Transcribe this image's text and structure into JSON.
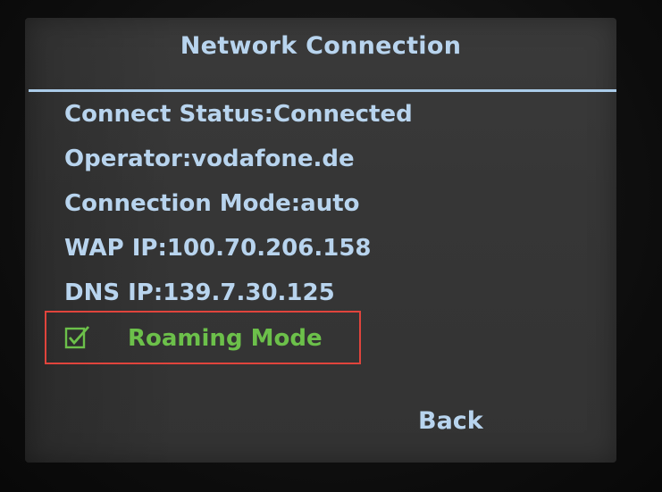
{
  "window": {
    "title": "Network Connection"
  },
  "info": {
    "connect_status": "Connect Status:Connected",
    "operator": "Operator:vodafone.de",
    "connection_mode": "Connection Mode:auto",
    "wap_ip": "WAP IP:100.70.206.158",
    "dns_ip": "DNS IP:139.7.30.125"
  },
  "roaming": {
    "label": "Roaming Mode",
    "checked": true,
    "icon": "checkbox-checked-icon"
  },
  "actions": {
    "back_label": "Back"
  },
  "colors": {
    "screen_bg": "#363636",
    "text": "#b8d4ee",
    "divider": "#aacbe8",
    "roaming_text": "#6cc04a",
    "highlight_box": "#e0443c"
  }
}
